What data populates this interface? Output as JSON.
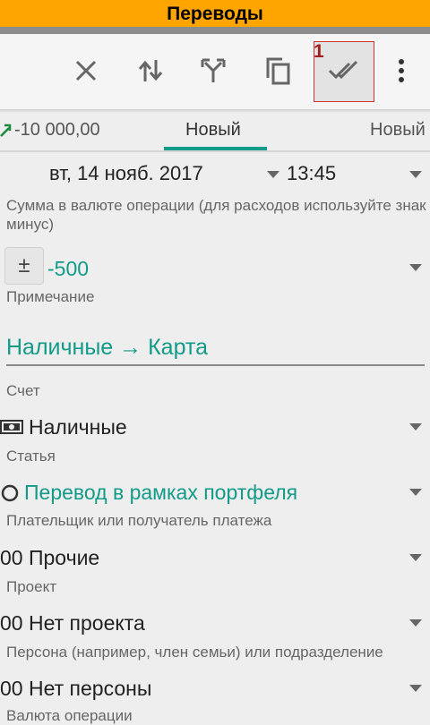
{
  "window": {
    "title": "Переводы"
  },
  "toolbar": {
    "badge": "1",
    "buttons": [
      {
        "icon": "close-icon"
      },
      {
        "icon": "swap-vertical-icon"
      },
      {
        "icon": "split-arrows-icon"
      },
      {
        "icon": "copy-icon"
      },
      {
        "icon": "double-check-icon"
      },
      {
        "icon": "more-vertical-icon"
      }
    ]
  },
  "tabs": [
    {
      "label": "-10 000,00"
    },
    {
      "label": "Новый",
      "active": true
    },
    {
      "label": "Новый"
    }
  ],
  "form": {
    "date": "вт, 14 нояб. 2017",
    "time": "13:45",
    "amount_label": "Сумма в валюте операции (для расходов используйте знак минус)",
    "sign_toggle": "±",
    "amount_value": "-500",
    "note_label": "Примечание",
    "note_value": "Наличные → Карта",
    "account_label": "Счет",
    "account_value": "Наличные",
    "category_label": "Статья",
    "category_value": "Перевод в рамках портфеля",
    "payee_label": "Плательщик или получатель платежа",
    "payee_value": "00 Прочие",
    "project_label": "Проект",
    "project_value": "00 Нет проекта",
    "person_label": "Персона (например, член семьи) или подразделение",
    "person_value": "00 Нет персоны",
    "currency_label": "Валюта операции"
  },
  "colors": {
    "title_bar": "#ffa500",
    "accent": "#129b89",
    "badge": "#a02020"
  }
}
